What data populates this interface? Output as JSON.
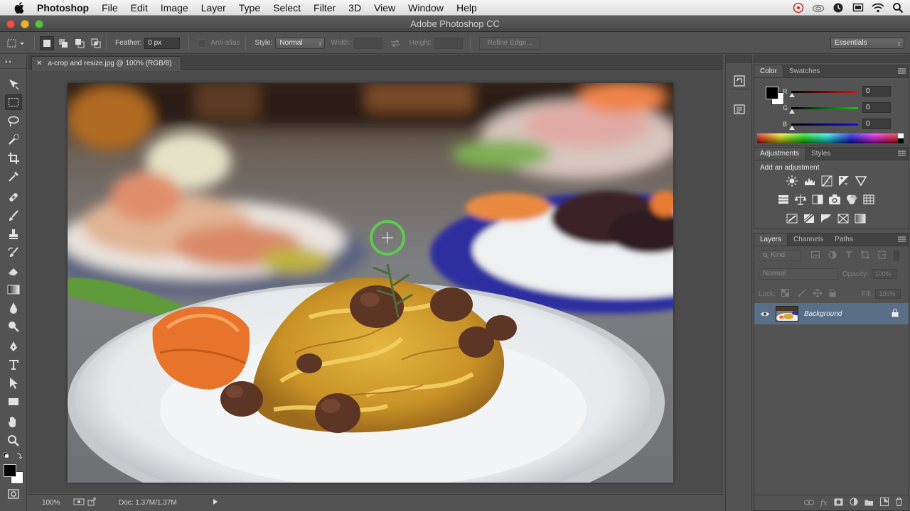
{
  "menubar": {
    "app_name": "Photoshop",
    "items": [
      "File",
      "Edit",
      "Image",
      "Layer",
      "Type",
      "Select",
      "Filter",
      "3D",
      "View",
      "Window",
      "Help"
    ],
    "status_icons": [
      "creative-cloud-icon",
      "cloud-icon",
      "time-machine-icon",
      "screen-icon",
      "wifi-icon",
      "spotlight-icon"
    ]
  },
  "window": {
    "title": "Adobe Photoshop CC"
  },
  "options": {
    "feather_label": "Feather:",
    "feather_value": "0 px",
    "antialias_label": "Anti-alias",
    "style_label": "Style:",
    "style_value": "Normal",
    "width_label": "Width:",
    "height_label": "Height:",
    "refine_edge": "Refine Edge...",
    "workspace": "Essentials"
  },
  "document": {
    "tab_title": "a-crop and resize.jpg @ 100% (RGB/8)",
    "zoom": "100%",
    "doc_size": "Doc: 1.37M/1.37M"
  },
  "color_panel": {
    "tabs": [
      "Color",
      "Swatches"
    ],
    "channels": [
      {
        "label": "R",
        "value": "0"
      },
      {
        "label": "G",
        "value": "0"
      },
      {
        "label": "B",
        "value": "0"
      }
    ],
    "foreground": "#000000",
    "background": "#ffffff"
  },
  "adjustments_panel": {
    "tabs": [
      "Adjustments",
      "Styles"
    ],
    "heading": "Add an adjustment"
  },
  "layers_panel": {
    "tabs": [
      "Layers",
      "Channels",
      "Paths"
    ],
    "kind_label": "Kind",
    "blend_mode": "Normal",
    "opacity_label": "Opacity:",
    "opacity_value": "100%",
    "lock_label": "Lock:",
    "fill_label": "Fill:",
    "fill_value": "100%",
    "layers": [
      {
        "name": "Background"
      }
    ]
  },
  "colors": {
    "selection_blue": "#596e87",
    "panel_gray": "#535353"
  }
}
